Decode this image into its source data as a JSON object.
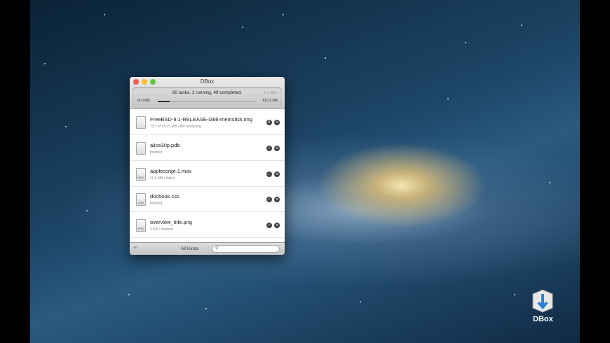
{
  "window": {
    "title": "DBox"
  },
  "status": {
    "summary": "60 tasks, 1 running, 49 completed.",
    "speed": "1.0 MB/s",
    "downloaded": "74.0 MB",
    "total": "610.5 MB",
    "progress_fraction": 0.121
  },
  "tasks": [
    {
      "name": "FreeBSD-9.1-RELEASE-i386-memstick.img",
      "detail": "73.7 of 610.5 MB  •  8m remaining",
      "icon_label": "",
      "action": "pause"
    },
    {
      "name": "alice30p.pdb",
      "detail": "finished",
      "icon_label": "",
      "action": "reveal"
    },
    {
      "name": "applescript-1.mov",
      "detail": "11.8 MB  •  failed",
      "icon_label": "MOV",
      "action": "download"
    },
    {
      "name": "docbook.css",
      "detail": "finished",
      "icon_label": "CSS",
      "action": "reveal"
    },
    {
      "name": "overview_title.png",
      "detail": "5 KB  •  finished",
      "icon_label": "PNG",
      "action": "reveal"
    }
  ],
  "footer": {
    "kinds": "All Kinds",
    "search_placeholder": ""
  },
  "dock": {
    "app_label": "DBox"
  },
  "colors": {
    "close": "#f25c54",
    "minimize": "#f6bd3a",
    "zoom": "#5fc548"
  }
}
